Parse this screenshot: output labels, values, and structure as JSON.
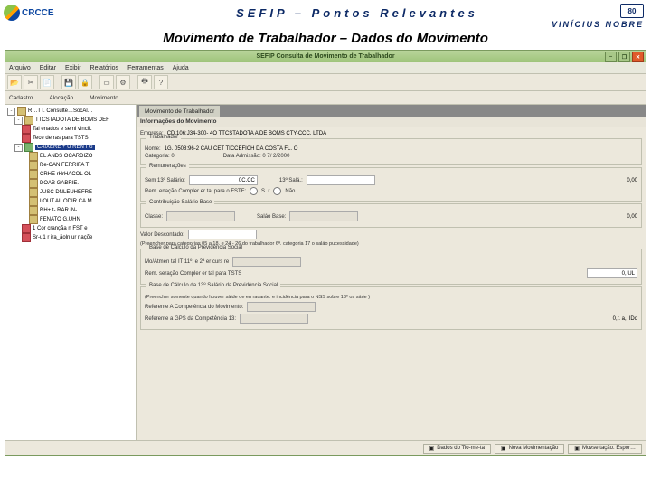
{
  "slide": {
    "logo_text": "CRCCE",
    "title": "SEFIP – Pontos Relevantes",
    "badge": "80",
    "author": "VINÍCIUS NOBRE",
    "subtitle": "Movimento de Trabalhador – Dados do Movimento"
  },
  "app": {
    "title": "SEFIP  Consulta de Movimento de Trabalhador",
    "menu": [
      "Arquivo",
      "Editar",
      "Exibir",
      "Relatórios",
      "Ferramentas",
      "Ajuda"
    ],
    "subtoolbar": [
      "Cadastro",
      "Alocação",
      "Movimento"
    ]
  },
  "tree": {
    "root": "R…TT. Consulte…SocAl…",
    "nodes": [
      "TTCSTADOTA DE BOMS DEF",
      "Tal enados e semi vinciL",
      "Tece de ras para TSTS"
    ],
    "selected": "CAIXERE + U REN I G",
    "items": [
      "EL ANDS OCARDIZO",
      "Re-CAN FERRIFA T",
      "CRHE rHrHACOL OL",
      "DOAB GABRIE.",
      "JUSC DNLEUHEFRE",
      "LOUT.AL.ODIR.CA.M",
      "RH+ t- RAR iN-",
      "FENATO G.UHN",
      "1  Cor crançãa n FST e",
      "Sr-u1 r ira_ãoln ur naçõe"
    ]
  },
  "panel": {
    "tab": "Movimento de Trabalhador",
    "section": "Informações do Movimento",
    "empresa_lbl": "Empresa:",
    "empresa_val": "CD.106:J34-300- 4O  TTCSTADOTA A DE BOMS  CTY-CCC. LTDA",
    "trab_legend": "Trabalhador",
    "trab_nome_lbl": "Nome:",
    "trab_nome_val": "1G. 0508:96-2  CAU CET TICCEFICH DA COSTA FL. O",
    "cat_lbl": "Categoria: 0",
    "adm_lbl": "Data Admissão: 0 7/ 2/2000",
    "rem_legend": "Remunerações",
    "sem13_lbl": "Sem 13º Salário:",
    "sem13_val": "0C.CC",
    "sal13_lbl": "13º Salá.:",
    "rem_total": "0,00",
    "remcomp_lbl": "Rem. enação Compler er tal para o FSTF: ",
    "remcomp_opts": [
      "S. r",
      "Não"
    ],
    "contr_legend": "Contribuição Salário Base",
    "classe_lbl": "Classe:",
    "salbase_lbl": "Saláo Base:",
    "contr_total": "0,00",
    "valdesc_lbl": "Valor Descontado:",
    "valdesc_note": "(Preencher para categorias 05 a 18, e 24 - 26 do trabalhador 6ª. categoria 17 o saláo pucessidade)",
    "bcps_legend": "Base de Cálculo da Previdência Social",
    "mov_lbl": "Mo/Atmen tal IT  11º, e 2ª  er curs re",
    "remcomp2_lbl": "Rem. seração Compler er tal para TSTS",
    "remcomp2_val": "0,  UL",
    "bc13_legend": "Base de Cálculo da 13º Salário da Previdência Social",
    "bc13_note": "(Preencher somente quando houver   sàide de en racante. e incidência para o  NSS sobre  13º os sárie )",
    "ref_lbl": "Referente A Competência do Movimento:",
    "gps_lbl": "Referente a GPS da Competência 13:",
    "gps_val": "0,r. a,l IDo"
  },
  "footer": {
    "b1": "Dados do Tio-me-ta",
    "b2": "Nova Movimentação",
    "b3": "Movse tação. Espor…"
  }
}
